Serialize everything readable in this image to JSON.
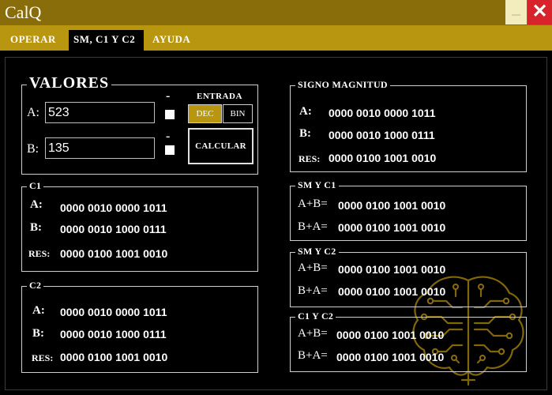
{
  "window": {
    "title": "CalQ"
  },
  "tabs": [
    {
      "label": "OPERAR"
    },
    {
      "label": "SM, C1 Y C2"
    },
    {
      "label": "AYUDA"
    }
  ],
  "valores": {
    "title": "VALORES",
    "a_label": "A:",
    "a_value": "523",
    "b_label": "B:",
    "b_value": "135",
    "neg_a": "-",
    "neg_b": "-",
    "entrada_label": "ENTRADA",
    "dec_label": "DEC",
    "bin_label": "BIN",
    "selected_mode": "DEC",
    "calc_label": "CALCULAR"
  },
  "c1": {
    "title": "C1",
    "a_label": "A:",
    "a": "0000 0010 0000 1011",
    "b_label": "B:",
    "b": "0000 0010 1000 0111",
    "res_label": "RES:",
    "res": "0000 0100 1001 0010"
  },
  "c2": {
    "title": "C2",
    "a_label": "A:",
    "a": "0000 0010 0000 1011",
    "b_label": "B:",
    "b": "0000 0010 1000 0111",
    "res_label": "RES:",
    "res": "0000 0100 1001 0010"
  },
  "sm": {
    "title": "SIGNO MAGNITUD",
    "a_label": "A:",
    "a": "0000 0010 0000 1011",
    "b_label": "B:",
    "b": "0000 0010 1000 0111",
    "res_label": "RES:",
    "res": "0000 0100 1001 0010"
  },
  "sm_c1": {
    "title": "SM Y C1",
    "apb_label": "A+B=",
    "apb": "0000 0100 1001 0010",
    "bpa_label": "B+A=",
    "bpa": "0000 0100 1001 0010"
  },
  "sm_c2": {
    "title": "SM Y C2",
    "apb_label": "A+B=",
    "apb": "0000 0100 1001 0010",
    "bpa_label": "B+A=",
    "bpa": "0000 0100 1001 0010"
  },
  "c1_c2": {
    "title": "C1 Y C2",
    "apb_label": "A+B=",
    "apb": "0000 0100 1001 0010",
    "bpa_label": "B+A=",
    "bpa": "0000 0100 1001 0010"
  },
  "colors": {
    "titlebar": "#8a6d0b",
    "tabbar": "#b8960f",
    "accent": "#b8960f",
    "close": "#d8232a",
    "watermark": "#8a6d0b"
  },
  "icons": {
    "minimize": "minimize-icon",
    "close": "close-icon",
    "watermark": "circuit-brain-icon"
  }
}
